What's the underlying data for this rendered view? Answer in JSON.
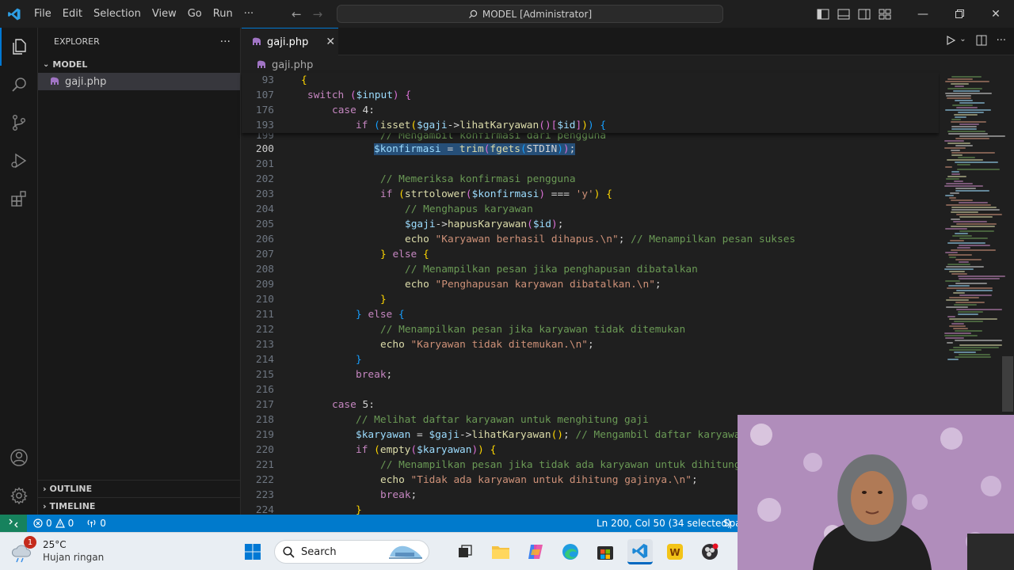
{
  "titlebar": {
    "menu": [
      "File",
      "Edit",
      "Selection",
      "View",
      "Go",
      "Run",
      "···"
    ],
    "command_center": "MODEL [Administrator]"
  },
  "sidebar": {
    "title": "EXPLORER",
    "more": "···",
    "folder": "MODEL",
    "file": "gaji.php",
    "outline": "OUTLINE",
    "timeline": "TIMELINE"
  },
  "editor": {
    "tab_label": "gaji.php",
    "breadcrumb_file": "gaji.php"
  },
  "sticky_lines": [
    {
      "n": "93"
    },
    {
      "n": "107"
    },
    {
      "n": "176"
    },
    {
      "n": "193"
    }
  ],
  "line_numbers": [
    "199",
    "200",
    "201",
    "202",
    "203",
    "204",
    "205",
    "206",
    "207",
    "208",
    "209",
    "210",
    "211",
    "212",
    "213",
    "214",
    "215",
    "216",
    "217",
    "218",
    "219",
    "220",
    "221",
    "222",
    "223",
    "224"
  ],
  "code_text": {
    "l93": "{",
    "l107_kw": "switch",
    "l107_var": "$input",
    "l176_kw": "case",
    "l176_rest": "4:",
    "l193_kw": "if",
    "l193_fn": "isset",
    "l193_var": "$gaji",
    "l193_method": "lihatKaryawan",
    "l193_id": "$id",
    "l199": "// Mengambil konfirmasi dari pengguna",
    "l200_var": "$konfirmasi",
    "l200_fn1": "trim",
    "l200_fn2": "fgets",
    "l200_const": "STDIN",
    "l202": "// Memeriksa konfirmasi pengguna",
    "l203_kw": "if",
    "l203_fn": "strtolower",
    "l203_var": "$konfirmasi",
    "l203_str": "'y'",
    "l204": "// Menghapus karyawan",
    "l205_var": "$gaji",
    "l205_fn": "hapusKaryawan",
    "l205_id": "$id",
    "l206_kw": "echo",
    "l206_str": "\"Karyawan berhasil dihapus.\\n\"",
    "l206_cm": "// Menampilkan pesan sukses",
    "l207_kw": "else",
    "l208": "// Menampilkan pesan jika penghapusan dibatalkan",
    "l209_kw": "echo",
    "l209_str": "\"Penghapusan karyawan dibatalkan.\\n\"",
    "l211_kw": "else",
    "l212": "// Menampilkan pesan jika karyawan tidak ditemukan",
    "l213_kw": "echo",
    "l213_str": "\"Karyawan tidak ditemukan.\\n\"",
    "l215_kw": "break",
    "l217_kw": "case",
    "l217_rest": "5:",
    "l218": "// Melihat daftar karyawan untuk menghitung gaji",
    "l219_var1": "$karyawan",
    "l219_var2": "$gaji",
    "l219_fn": "lihatKaryawan",
    "l219_cm": "// Mengambil daftar karyawa",
    "l220_kw": "if",
    "l220_fn": "empty",
    "l220_var": "$karyawan",
    "l221": "// Menampilkan pesan jika tidak ada karyawan untuk dihitung",
    "l222_kw": "echo",
    "l222_str": "\"Tidak ada karyawan untuk dihitung gajinya.\\n\"",
    "l223_kw": "break"
  },
  "statusbar": {
    "errors": "0",
    "warnings": "0",
    "ports": "0",
    "cursor": "Ln 200, Col 50 (34 selected)",
    "spaces": "Spa"
  },
  "taskbar": {
    "weather_badge": "1",
    "temperature": "25°C",
    "weather_desc": "Hujan ringan",
    "search_label": "Search"
  },
  "colors": {
    "accent": "#0078d4",
    "statusbar": "#007acc",
    "remote": "#16825d",
    "selection": "#264f78"
  }
}
